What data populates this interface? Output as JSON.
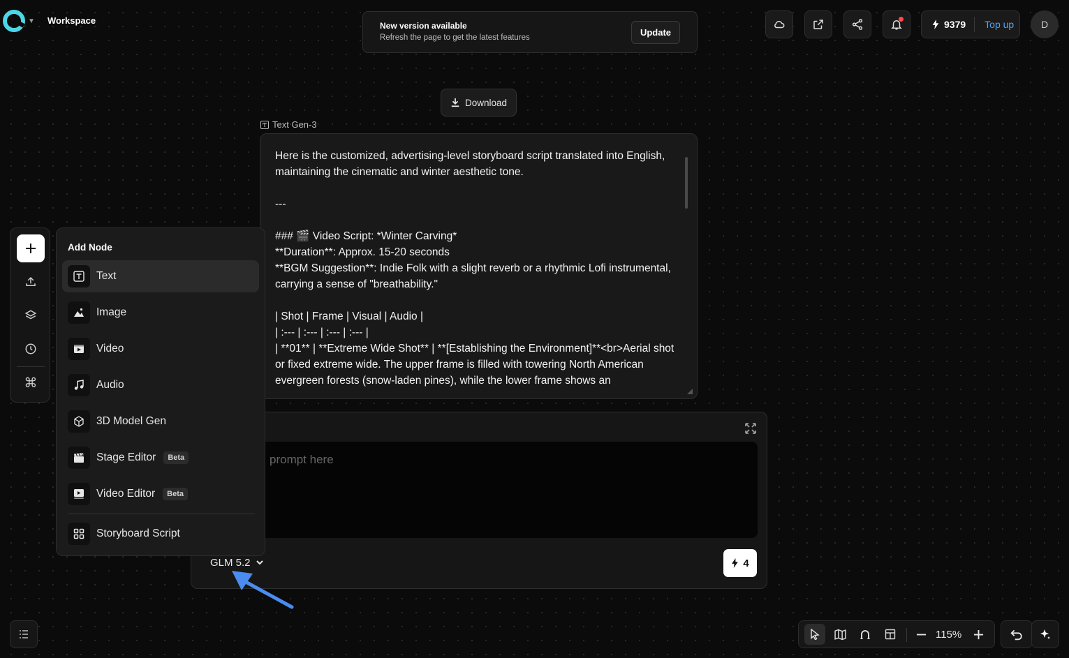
{
  "header": {
    "workspace_title": "Workspace",
    "banner_title": "New version available",
    "banner_subtitle": "Refresh the page to get the latest features",
    "update_label": "Update",
    "credits": "9379",
    "topup_label": "Top up",
    "avatar_initial": "D",
    "icons": [
      "cloud-icon",
      "external-link-icon",
      "share-icon",
      "bell-icon"
    ]
  },
  "download_label": "Download",
  "text_node": {
    "label": "Text Gen-3",
    "content": "Here is the customized, advertising-level storyboard script translated into English, maintaining the cinematic and winter aesthetic tone.\n\n---\n\n### 🎬 Video Script: *Winter Carving*\n**Duration**: Approx. 15-20 seconds\n**BGM Suggestion**: Indie Folk with a slight reverb or a rhythmic Lofi instrumental, carrying a sense of \"breathability.\"\n\n| Shot | Frame | Visual | Audio |\n| :--- | :--- | :--- | :--- |\n| **01** | **Extreme Wide Shot** | **[Establishing the Environment]**<br>Aerial shot or fixed extreme wide. The upper frame is filled with towering North American evergreen forests (snow-laden pines), while the lower frame shows an"
  },
  "prompt": {
    "placeholder": "prompt here",
    "model": "GLM 5.2",
    "cost": "4"
  },
  "menu": {
    "title": "Add Node",
    "items": [
      {
        "label": "Text",
        "icon": "text-icon",
        "beta": ""
      },
      {
        "label": "Image",
        "icon": "image-icon",
        "beta": ""
      },
      {
        "label": "Video",
        "icon": "video-icon",
        "beta": ""
      },
      {
        "label": "Audio",
        "icon": "music-icon",
        "beta": ""
      },
      {
        "label": "3D Model Gen",
        "icon": "cube-icon",
        "beta": ""
      },
      {
        "label": "Stage Editor",
        "icon": "clapperboard-icon",
        "beta": "Beta"
      },
      {
        "label": "Video Editor",
        "icon": "video-editor-icon",
        "beta": "Beta"
      },
      {
        "label": "Storyboard Script",
        "icon": "grid-icon",
        "beta": ""
      }
    ]
  },
  "zoom_level": "115%",
  "colors": {
    "accent": "#4ea3ff",
    "background": "#0b0b0b",
    "panel": "#191919",
    "annotation_arrow": "#4a8cf0",
    "notification_dot": "#ff4d4f"
  }
}
